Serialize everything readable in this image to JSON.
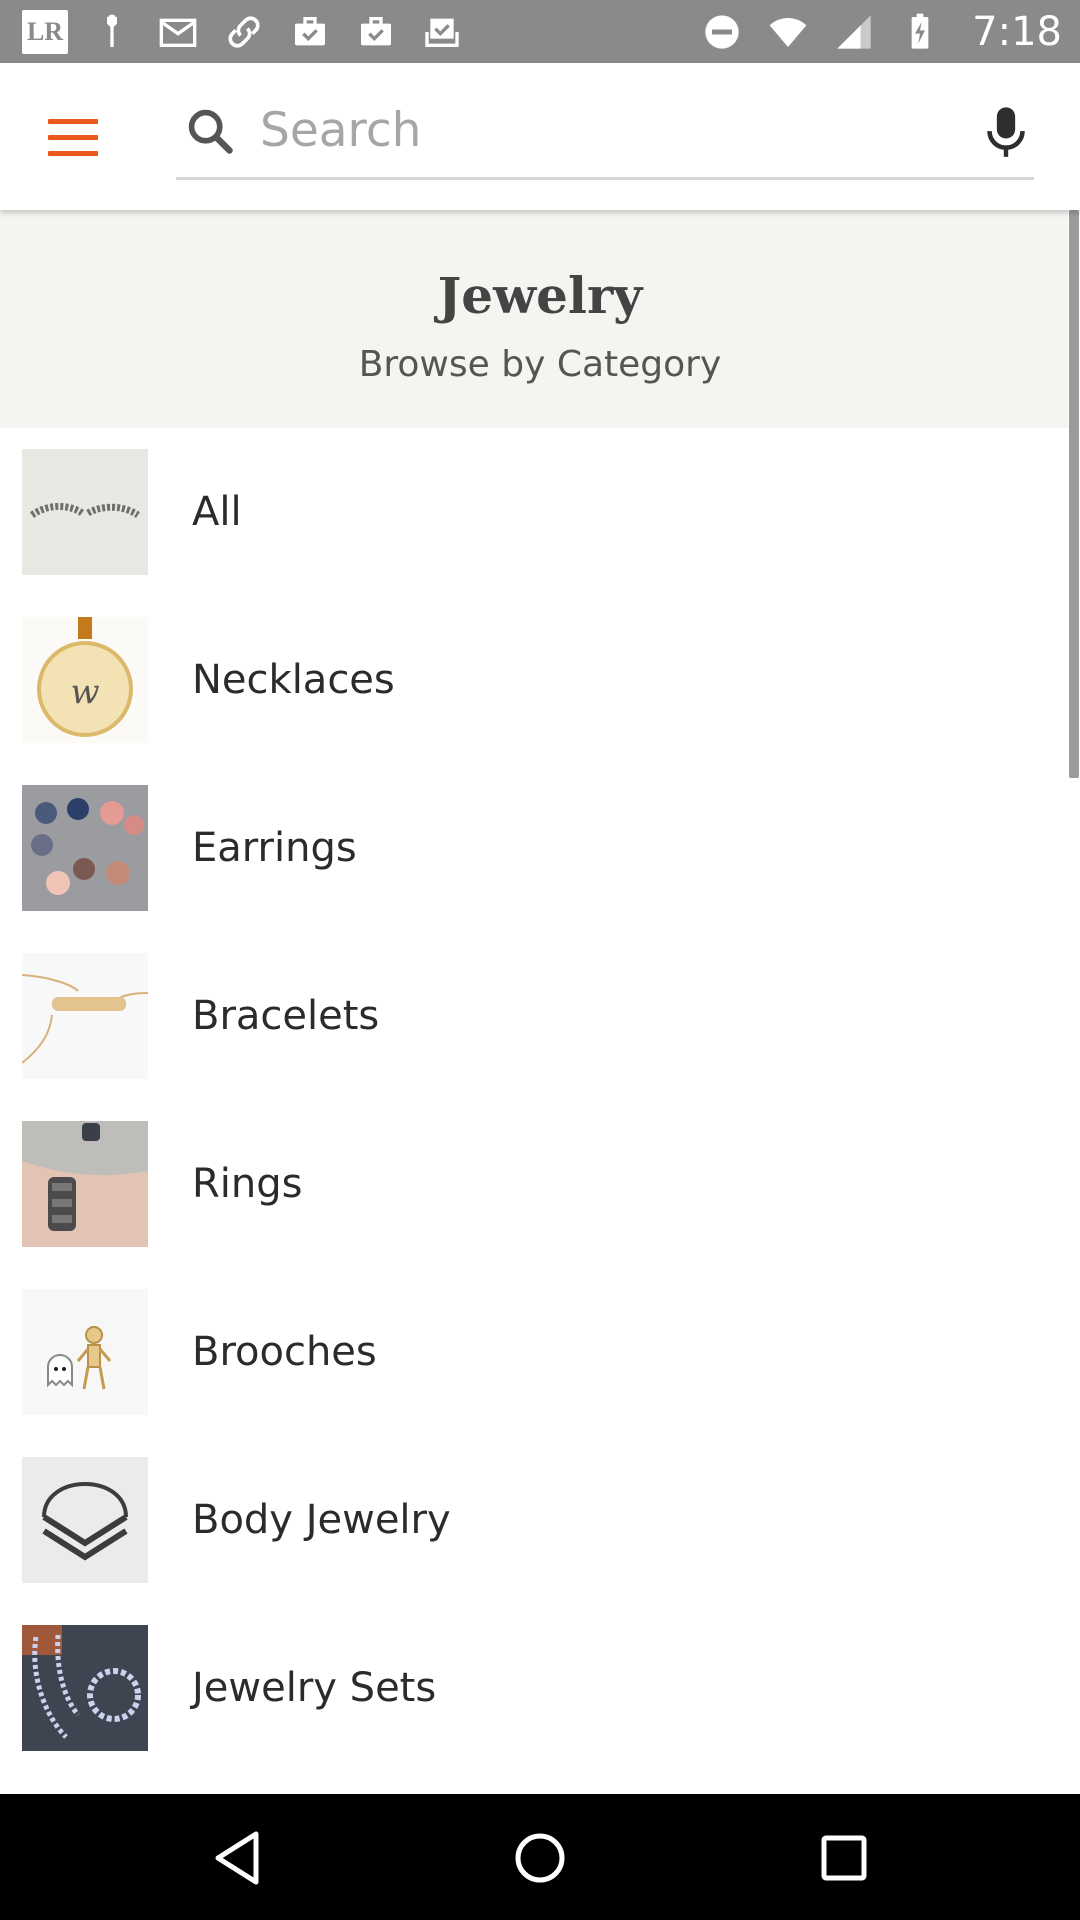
{
  "status_bar": {
    "left_icons": [
      "lr-app-icon",
      "notification-icon",
      "gmail-icon",
      "link-icon",
      "briefcase-check-icon",
      "briefcase-check-icon",
      "inbox-check-icon"
    ],
    "lr_text": "LR",
    "right_icons": [
      "do-not-disturb-icon",
      "wifi-icon",
      "cellular-signal-icon",
      "battery-charging-icon"
    ],
    "time": "7:18"
  },
  "app_bar": {
    "menu_icon": "hamburger-menu-icon",
    "search": {
      "placeholder": "Search",
      "value": ""
    },
    "mic_icon": "microphone-icon"
  },
  "header": {
    "title": "Jewelry",
    "subtitle": "Browse by Category"
  },
  "categories": [
    {
      "label": "All"
    },
    {
      "label": "Necklaces"
    },
    {
      "label": "Earrings"
    },
    {
      "label": "Bracelets"
    },
    {
      "label": "Rings"
    },
    {
      "label": "Brooches"
    },
    {
      "label": "Body Jewelry"
    },
    {
      "label": "Jewelry Sets"
    }
  ],
  "colors": {
    "accent": "#e8591a",
    "status_bar": "#8a8a8a",
    "header_band": "#f5f4f0",
    "nav_bar": "#000000"
  },
  "nav_bar": [
    "back-icon",
    "home-icon",
    "recents-icon"
  ]
}
